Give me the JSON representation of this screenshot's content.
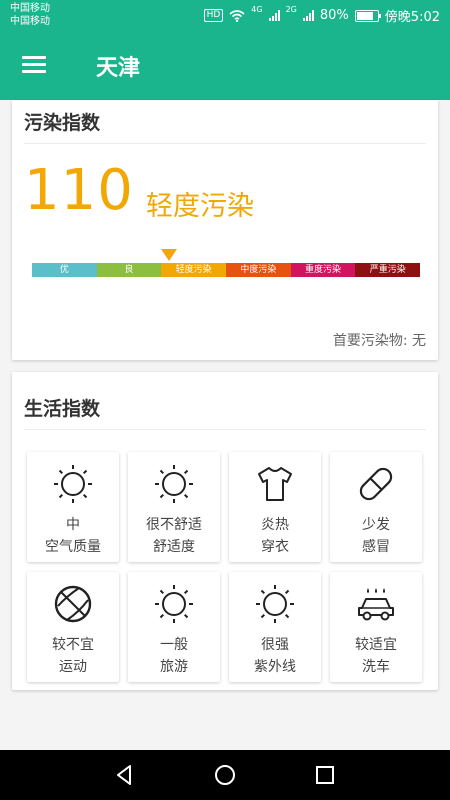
{
  "status_bar": {
    "carrier1": "中国移动",
    "carrier2": "中国移动",
    "hd": "HD",
    "net1": "4G",
    "net2": "2G",
    "battery": "80%",
    "time": "傍晚5:02"
  },
  "app_bar": {
    "title": "天津"
  },
  "pollution": {
    "heading": "污染指数",
    "aqi": "110",
    "level": "轻度污染",
    "scale": [
      {
        "label": "优",
        "color": "#5bbfc9"
      },
      {
        "label": "良",
        "color": "#8cbe3f"
      },
      {
        "label": "轻度污染",
        "color": "#f2a804"
      },
      {
        "label": "中度污染",
        "color": "#e8520f"
      },
      {
        "label": "重度污染",
        "color": "#d2145f"
      },
      {
        "label": "严重污染",
        "color": "#8f1010"
      }
    ],
    "primary_pollutant": "首要污染物: 无"
  },
  "life": {
    "heading": "生活指数",
    "items": [
      {
        "line1": "中",
        "line2": "空气质量",
        "icon": "sun-icon"
      },
      {
        "line1": "很不舒适",
        "line2": "舒适度",
        "icon": "sun-icon"
      },
      {
        "line1": "炎热",
        "line2": "穿衣",
        "icon": "tshirt-icon"
      },
      {
        "line1": "少发",
        "line2": "感冒",
        "icon": "pill-icon"
      },
      {
        "line1": "较不宜",
        "line2": "运动",
        "icon": "basketball-icon"
      },
      {
        "line1": "一般",
        "line2": "旅游",
        "icon": "sun-icon"
      },
      {
        "line1": "很强",
        "line2": "紫外线",
        "icon": "sun-icon"
      },
      {
        "line1": "较适宜",
        "line2": "洗车",
        "icon": "car-wash-icon"
      }
    ]
  },
  "colors": {
    "accent": "#1bb58d",
    "aqi": "#f2a804"
  }
}
